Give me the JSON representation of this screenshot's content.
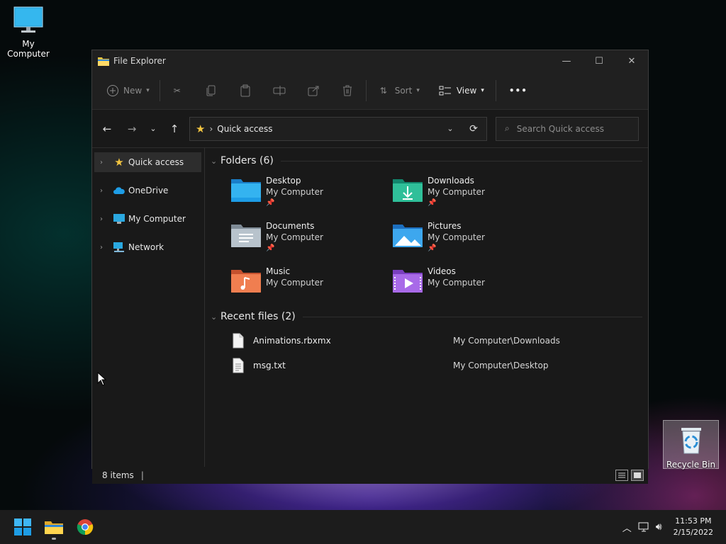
{
  "desktop": {
    "my_computer_label": "My Computer",
    "recycle_bin_label": "Recycle Bin"
  },
  "window": {
    "title": "File Explorer",
    "controls": {
      "minimize": "—",
      "maximize": "☐",
      "close": "✕"
    }
  },
  "toolbar": {
    "new_label": "New",
    "sort_label": "Sort",
    "view_label": "View",
    "more_label": "•••"
  },
  "address": {
    "path": "Quick access",
    "search_placeholder": "Search Quick access"
  },
  "navpane": {
    "items": [
      {
        "label": "Quick access",
        "icon": "star-icon",
        "selected": true
      },
      {
        "label": "OneDrive",
        "icon": "cloud-icon"
      },
      {
        "label": "My Computer",
        "icon": "monitor-icon"
      },
      {
        "label": "Network",
        "icon": "network-icon"
      }
    ]
  },
  "folders_group": {
    "header": "Folders (6)",
    "items": [
      {
        "name": "Desktop",
        "location": "My Computer",
        "pinned": true,
        "icon": "desktop-folder-icon"
      },
      {
        "name": "Downloads",
        "location": "My Computer",
        "pinned": true,
        "icon": "downloads-folder-icon"
      },
      {
        "name": "Documents",
        "location": "My Computer",
        "pinned": true,
        "icon": "documents-folder-icon"
      },
      {
        "name": "Pictures",
        "location": "My Computer",
        "pinned": true,
        "icon": "pictures-folder-icon"
      },
      {
        "name": "Music",
        "location": "My Computer",
        "pinned": false,
        "icon": "music-folder-icon"
      },
      {
        "name": "Videos",
        "location": "My Computer",
        "pinned": false,
        "icon": "videos-folder-icon"
      }
    ]
  },
  "recent_group": {
    "header": "Recent files (2)",
    "items": [
      {
        "name": "Animations.rbxmx",
        "path": "My Computer\\Downloads",
        "icon": "file-icon"
      },
      {
        "name": "msg.txt",
        "path": "My Computer\\Desktop",
        "icon": "text-file-icon"
      }
    ]
  },
  "statusbar": {
    "count": "8 items",
    "caret": "|"
  },
  "taskbar": {
    "time": "11:53 PM",
    "date": "2/15/2022"
  },
  "colors": {
    "accent_blue": "#1e9de6",
    "folder_yellow": "#f2c541",
    "window_bg": "#191919"
  }
}
